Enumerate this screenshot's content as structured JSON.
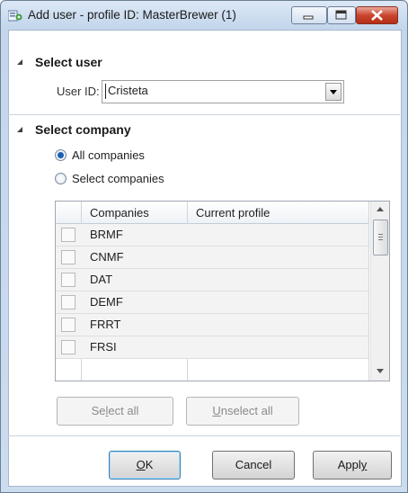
{
  "window": {
    "title": "Add user - profile ID: MasterBrewer (1)",
    "icon": "form-icon",
    "controls": [
      "minimize-icon",
      "maximize-icon",
      "close-icon"
    ]
  },
  "select_user": {
    "heading": "Select user",
    "user_id_label": "User ID:",
    "user_id_value": "Cristeta"
  },
  "select_company": {
    "heading": "Select company",
    "options": [
      {
        "label": "All companies",
        "selected": true
      },
      {
        "label": "Select companies",
        "selected": false
      }
    ],
    "grid": {
      "columns": [
        "Companies",
        "Current profile"
      ],
      "rows": [
        {
          "company": "BRMF",
          "current_profile": "",
          "checked": false
        },
        {
          "company": "CNMF",
          "current_profile": "",
          "checked": false
        },
        {
          "company": "DAT",
          "current_profile": "",
          "checked": false
        },
        {
          "company": "DEMF",
          "current_profile": "",
          "checked": false
        },
        {
          "company": "FRRT",
          "current_profile": "",
          "checked": false
        },
        {
          "company": "FRSI",
          "current_profile": "",
          "checked": false
        }
      ]
    },
    "select_all": {
      "pre": "Se",
      "hot": "l",
      "post": "ect all"
    },
    "unselect_all": {
      "pre": "",
      "hot": "U",
      "post": "nselect all"
    }
  },
  "buttons": {
    "ok": {
      "pre": "",
      "hot": "O",
      "post": "K"
    },
    "cancel": "Cancel",
    "apply": {
      "pre": "Appl",
      "hot": "y",
      "post": ""
    }
  },
  "colors": {
    "frame": "#c3d6ec",
    "close_button": "#c9452e",
    "radio_selected": "#1b5fb5"
  }
}
